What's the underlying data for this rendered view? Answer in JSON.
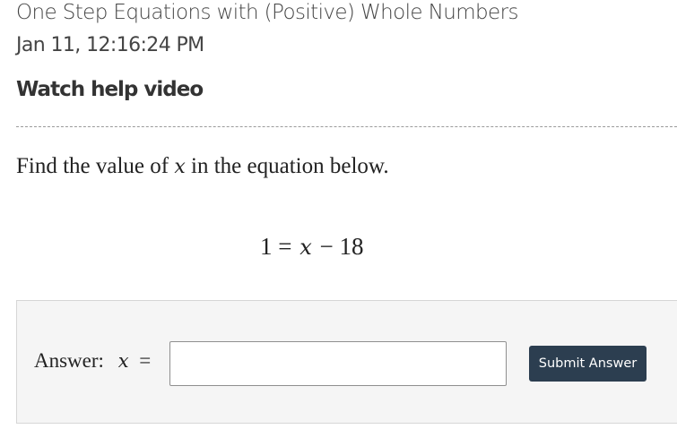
{
  "header": {
    "title": "One Step Equations with (Positive) Whole Numbers",
    "timestamp": "Jan 11, 12:16:24 PM",
    "help_link": "Watch help video"
  },
  "question": {
    "prefix": "Find the value of",
    "variable": "x",
    "suffix": "in the equation below."
  },
  "equation": {
    "left": "1",
    "equals": "=",
    "variable": "x",
    "operator": "−",
    "right": "18"
  },
  "answer": {
    "label": "Answer:",
    "variable": "x",
    "equals": "=",
    "input_value": "",
    "submit_label": "Submit Answer"
  }
}
